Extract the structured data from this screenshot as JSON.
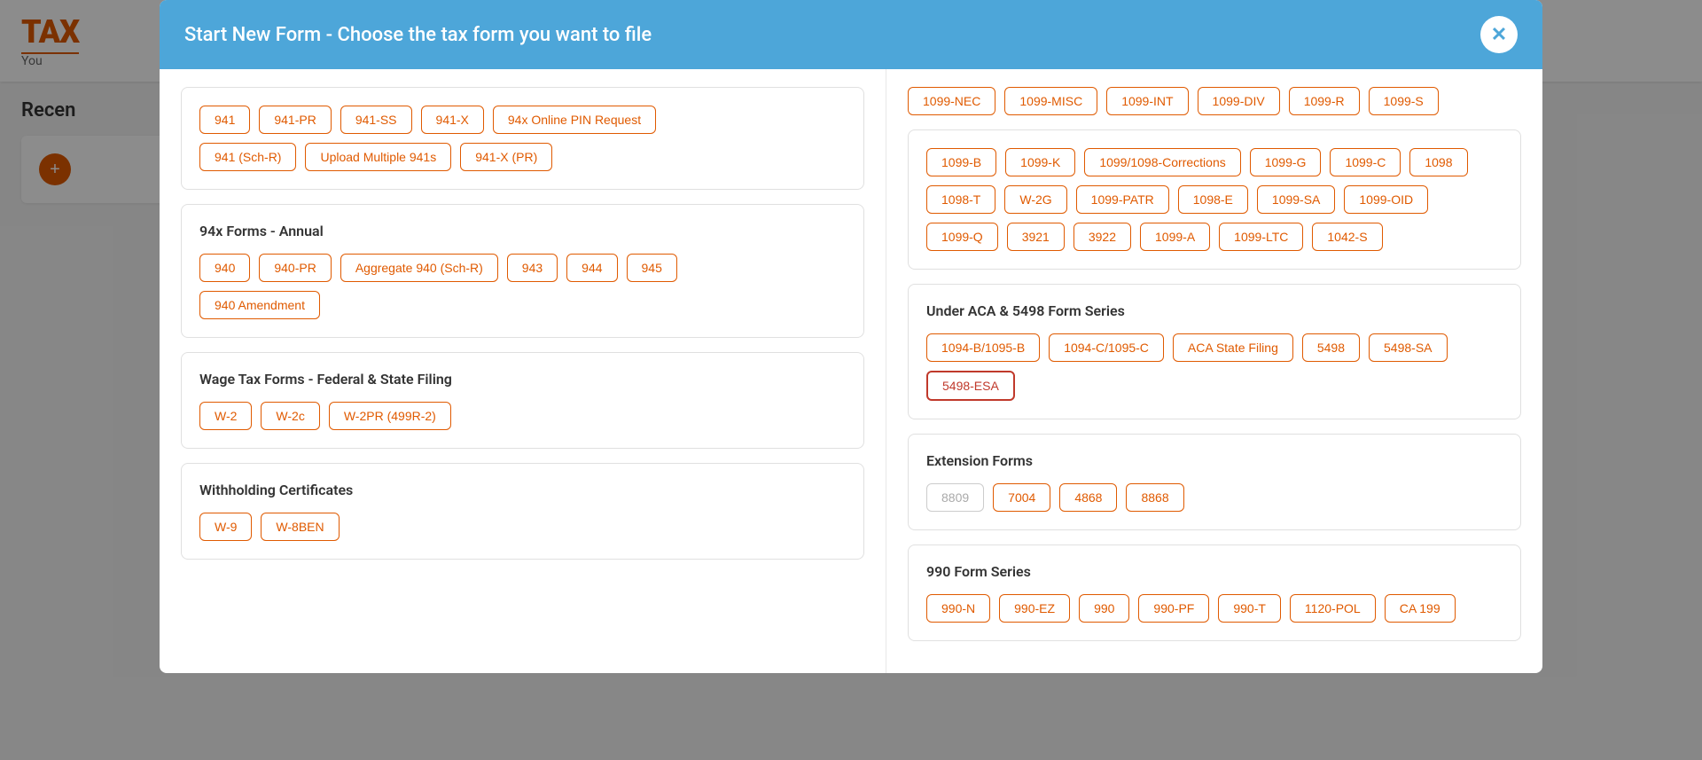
{
  "app": {
    "logo_tax": "TAX",
    "logo_you": "You",
    "recent_label": "Recen"
  },
  "modal": {
    "title": "Start New Form - Choose the tax form you want to file",
    "close_label": "✕"
  },
  "left_sections": [
    {
      "id": "94x-quarterly",
      "title": null,
      "top_buttons": [
        "941",
        "941-PR",
        "941-SS",
        "941-X",
        "94x Online PIN Request"
      ],
      "bottom_buttons": [
        "941 (Sch-R)",
        "Upload Multiple 941s",
        "941-X (PR)"
      ]
    },
    {
      "id": "94x-annual",
      "title": "94x Forms - Annual",
      "top_buttons": [
        "940",
        "940-PR",
        "Aggregate 940 (Sch-R)",
        "943",
        "944",
        "945"
      ],
      "bottom_buttons": [
        "940 Amendment"
      ]
    },
    {
      "id": "wage-tax",
      "title": "Wage Tax Forms - Federal & State Filing",
      "top_buttons": [
        "W-2",
        "W-2c",
        "W-2PR (499R-2)"
      ],
      "bottom_buttons": []
    },
    {
      "id": "withholding",
      "title": "Withholding Certificates",
      "top_buttons": [
        "W-9",
        "W-8BEN"
      ],
      "bottom_buttons": []
    }
  ],
  "right_top_buttons": [
    "1099-NEC",
    "1099-MISC",
    "1099-INT",
    "1099-DIV",
    "1099-R",
    "1099-S"
  ],
  "right_sections": [
    {
      "id": "1099-series",
      "title": null,
      "rows": [
        [
          "1099-B",
          "1099-K",
          "1099/1098-Corrections",
          "1099-G",
          "1099-C",
          "1098"
        ],
        [
          "1098-T",
          "W-2G",
          "1099-PATR",
          "1098-E",
          "1099-SA",
          "1099-OID"
        ],
        [
          "1099-Q",
          "3921",
          "3922",
          "1099-A",
          "1099-LTC",
          "1042-S"
        ]
      ]
    },
    {
      "id": "aca-5498",
      "title": "Under ACA & 5498 Form Series",
      "rows": [
        [
          "1094-B/1095-B",
          "1094-C/1095-C",
          "ACA State Filing",
          "5498",
          "5498-SA"
        ],
        [
          "5498-ESA"
        ]
      ],
      "selected": "5498-ESA"
    },
    {
      "id": "extension",
      "title": "Extension Forms",
      "rows": [
        [
          "8809",
          "7004",
          "4868",
          "8868"
        ]
      ],
      "disabled": [
        "8809"
      ]
    },
    {
      "id": "990-series",
      "title": "990 Form Series",
      "rows": [
        [
          "990-N",
          "990-EZ",
          "990",
          "990-PF",
          "990-T",
          "1120-POL",
          "CA 199"
        ]
      ]
    }
  ]
}
